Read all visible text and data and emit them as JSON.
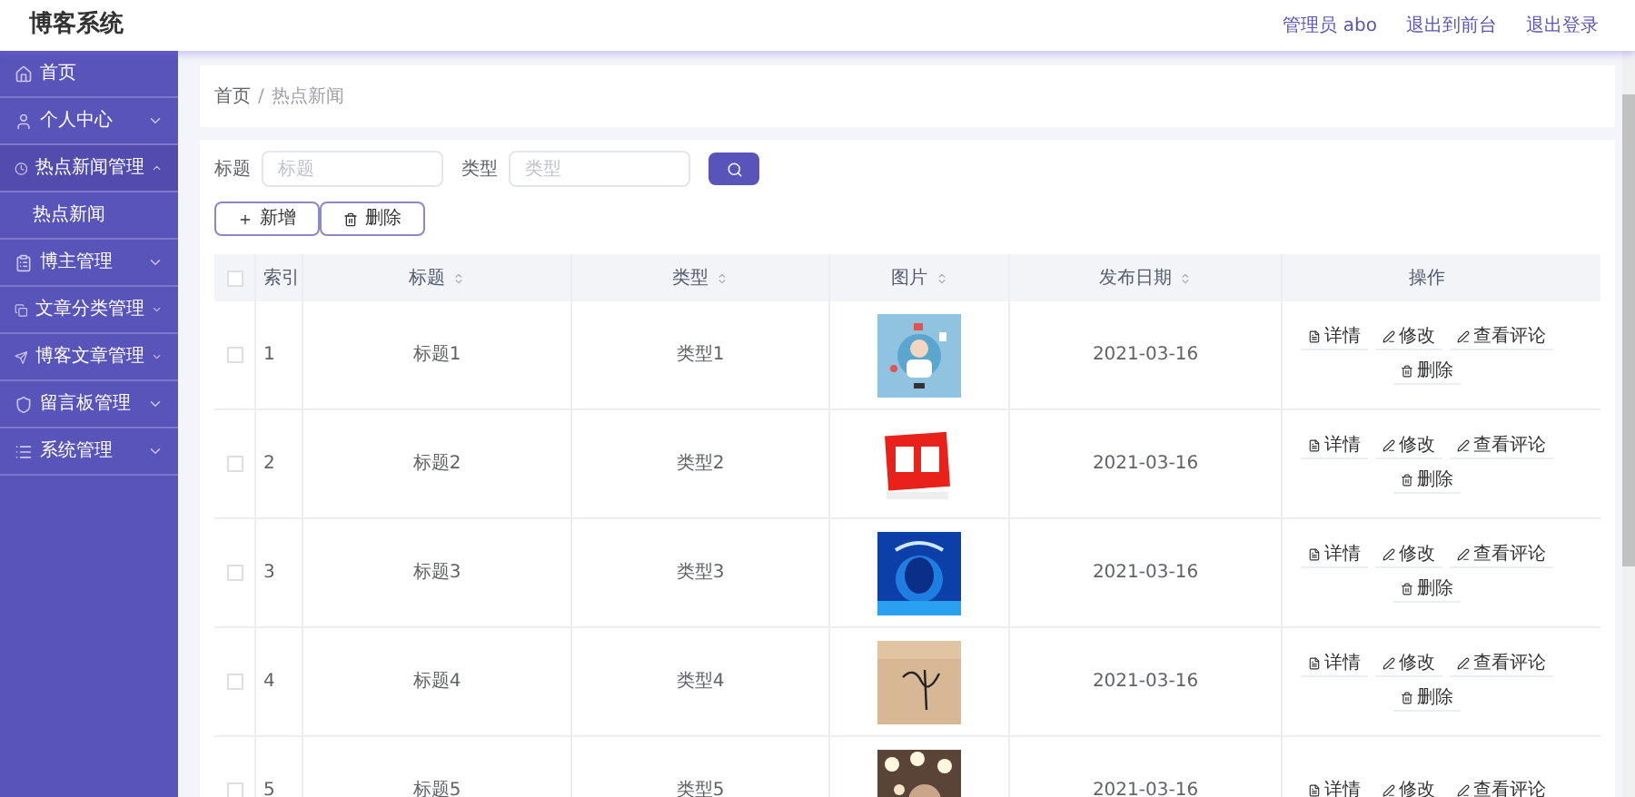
{
  "header": {
    "title": "博客系统",
    "links": [
      "管理员 abo",
      "退出到前台",
      "退出登录"
    ]
  },
  "sidebar": {
    "items": [
      {
        "label": "首页",
        "kind": "link"
      },
      {
        "label": "个人中心",
        "kind": "group",
        "expanded": false
      },
      {
        "label": "热点新闻管理",
        "kind": "group",
        "expanded": true,
        "children": [
          {
            "label": "热点新闻"
          }
        ]
      },
      {
        "label": "博主管理",
        "kind": "group",
        "expanded": false
      },
      {
        "label": "文章分类管理",
        "kind": "group",
        "expanded": false
      },
      {
        "label": "博客文章管理",
        "kind": "group",
        "expanded": false
      },
      {
        "label": "留言板管理",
        "kind": "group",
        "expanded": false
      },
      {
        "label": "系统管理",
        "kind": "group",
        "expanded": false
      }
    ]
  },
  "breadcrumb": [
    "首页",
    "/",
    "热点新闻"
  ],
  "filters": [
    {
      "label": "标题",
      "placeholder": "标题"
    },
    {
      "label": "类型",
      "placeholder": "类型"
    }
  ],
  "toolbar": [
    "新增",
    "删除"
  ],
  "table": {
    "all_checked": false,
    "columns": [
      {
        "label": "索引",
        "sortable": false
      },
      {
        "label": "标题",
        "sortable": true
      },
      {
        "label": "类型",
        "sortable": true
      },
      {
        "label": "图片",
        "sortable": true
      },
      {
        "label": "发布日期",
        "sortable": true
      },
      {
        "label": "操作",
        "sortable": false
      }
    ],
    "rows": [
      {
        "checked": false,
        "index": "1",
        "title": "标题1",
        "type": "类型1",
        "image": {
          "kind": "picture"
        },
        "date": "2021-03-16",
        "actions": [
          "详情",
          "修改",
          "查看评论",
          "删除"
        ]
      },
      {
        "checked": false,
        "index": "2",
        "title": "标题2",
        "type": "类型2",
        "image": {
          "kind": "picture"
        },
        "date": "2021-03-16",
        "actions": [
          "详情",
          "修改",
          "查看评论",
          "删除"
        ]
      },
      {
        "checked": false,
        "index": "3",
        "title": "标题3",
        "type": "类型3",
        "image": {
          "kind": "picture"
        },
        "date": "2021-03-16",
        "actions": [
          "详情",
          "修改",
          "查看评论",
          "删除"
        ]
      },
      {
        "checked": false,
        "index": "4",
        "title": "标题4",
        "type": "类型4",
        "image": {
          "kind": "picture"
        },
        "date": "2021-03-16",
        "actions": [
          "详情",
          "修改",
          "查看评论",
          "删除"
        ]
      },
      {
        "checked": false,
        "index": "5",
        "title": "标题5",
        "type": "类型5",
        "image": {
          "kind": "picture"
        },
        "date": "2021-03-16",
        "actions": [
          "详情",
          "修改",
          "查看评论"
        ]
      }
    ]
  }
}
